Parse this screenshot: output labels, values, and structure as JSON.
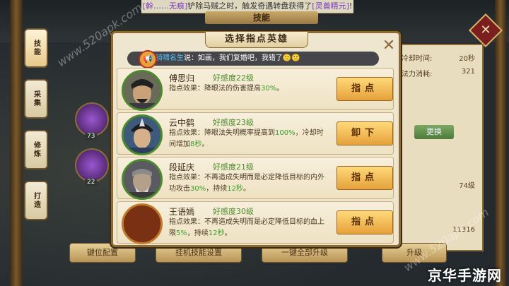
{
  "top_banner": {
    "prefix": "[幹……无痕]",
    "middle": "铲除马贼之时，触发奇遇转盘获得了",
    "item": "[灵兽精元]",
    "suffix": "!"
  },
  "panel_title": "技能",
  "side_tabs": [
    "技能",
    "采集",
    "修炼",
    "打造"
  ],
  "background_skills": [
    {
      "level": "73"
    },
    {
      "level": "22"
    }
  ],
  "right_panel": {
    "rows": [
      {
        "label": "冷却时间:",
        "value": "20秒"
      },
      {
        "label": "法力消耗:",
        "value": "321"
      }
    ],
    "change_button": "更换",
    "level_text": "74级",
    "stat_value": "11316"
  },
  "bottom_buttons": [
    "键位配置",
    "挂机技能设置",
    "一键全部升级",
    "升级"
  ],
  "modal": {
    "title": "选择指点英雄",
    "close_icon": "close-x-icon",
    "notice": {
      "channel": "[、",
      "speaker": "骑啸名生",
      "text": "说：如画，我们复婚吧，我错了",
      "emojis": "🙁🙁"
    },
    "heroes": [
      {
        "name": "傅思归",
        "favor": "好感度22级",
        "effect_prefix": "指点效果：降眼法的伤害提高",
        "effect_value": "30%",
        "effect_suffix": "。",
        "button": "指点",
        "ring_color": "#4d8a2e"
      },
      {
        "name": "云中鹤",
        "favor": "好感度23级",
        "effect_prefix": "指点效果：降眼法失明概率提高到",
        "effect_value": "100%",
        "effect_suffix": "，冷却时间增加",
        "effect_value2": "8秒",
        "effect_end": "。",
        "button": "卸下",
        "ring_color": "#4d8a2e"
      },
      {
        "name": "段延庆",
        "favor": "好感度21级",
        "effect_prefix": "指点效果：不再造成失明而是必定降低目标的内外功攻击",
        "effect_value": "30%",
        "effect_suffix": "，持续",
        "effect_value2": "12秒",
        "effect_end": "。",
        "button": "指点",
        "ring_color": "#4d8a2e"
      },
      {
        "name": "王语嫣",
        "favor": "好感度30级",
        "effect_prefix": "指点效果：不再造成失明而是必定降低目标的血上限",
        "effect_value": "5%",
        "effect_suffix": "，持续",
        "effect_value2": "12秒",
        "effect_end": "。",
        "button": "指点",
        "ring_color": "#c07a2a"
      }
    ]
  },
  "watermark": {
    "brand": "京华手游网",
    "url": "www.520apk.com"
  },
  "colors": {
    "accent_green": "#3aa02a",
    "button_gold": "#e6a13a",
    "frame_brown": "#8b6a34"
  }
}
